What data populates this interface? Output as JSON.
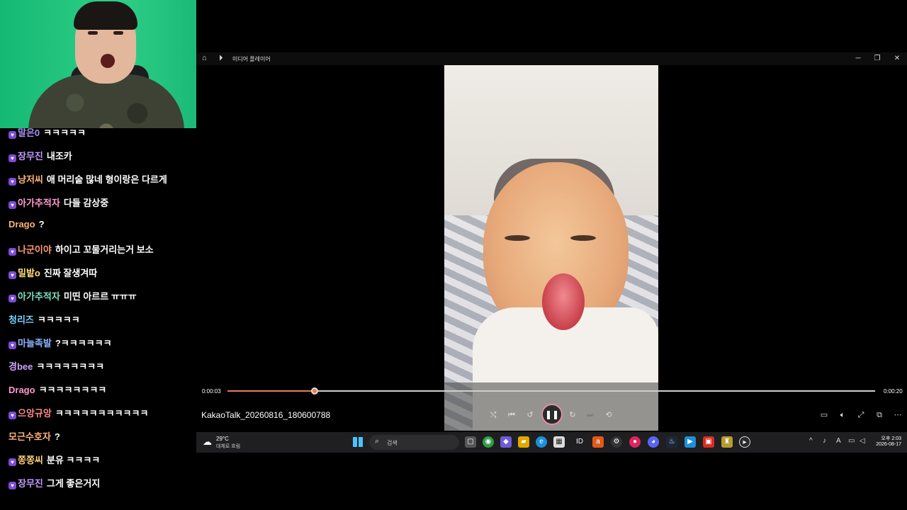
{
  "player": {
    "window_title": "미디어 플레이어",
    "file_name": "KakaoTalk_20260816_180600788",
    "time_elapsed": "0:00:03",
    "time_total": "0:00:20",
    "progress_fraction": 0.135,
    "accent_color": "#f07a4f"
  },
  "chat": {
    "messages": [
      {
        "nick": "말은0",
        "text": "ㅋㅋㅋㅋㅋ",
        "nick_color": "#a98df5",
        "badge": true
      },
      {
        "nick": "장무진",
        "text": "내조카",
        "nick_color": "#c49aff",
        "badge": true
      },
      {
        "nick": "냥저씨",
        "text": "애 머리숱 많네 형이랑은 다르게",
        "nick_color": "#ffb27a",
        "badge": true
      },
      {
        "nick": "아가추적자",
        "text": "다들 감상중",
        "nick_color": "#ff9ad0",
        "badge": true
      },
      {
        "nick": "Drago",
        "text": "?",
        "nick_color": "#ffb27a",
        "badge": false
      },
      {
        "nick": "나군이야",
        "text": "하이고 꼬물거리는거 보소",
        "nick_color": "#ff9a7a",
        "badge": true
      },
      {
        "nick": "밀밭o",
        "text": "진짜 잘생겨따",
        "nick_color": "#ffe17a",
        "badge": true
      },
      {
        "nick": "아가추적자",
        "text": "미띤 아르르 ㅠㅠㅠ",
        "nick_color": "#7ae0c0",
        "badge": true
      },
      {
        "nick": "청리즈",
        "text": "ㅋㅋㅋㅋㅋ",
        "nick_color": "#7ad0ff",
        "badge": false
      },
      {
        "nick": "마늘족발",
        "text": "?ㅋㅋㅋㅋㅋㅋ",
        "nick_color": "#8fb4ff",
        "badge": true
      },
      {
        "nick": "경bee",
        "text": "ㅋㅋㅋㅋㅋㅋㅋㅋ",
        "nick_color": "#cfa0ff",
        "badge": false
      },
      {
        "nick": "Drago",
        "text": "ㅋㅋㅋㅋㅋㅋㅋㅋ",
        "nick_color": "#ff9ad0",
        "badge": false
      },
      {
        "nick": "으앙규앙",
        "text": "ㅋㅋㅋㅋㅋㅋㅋㅋㅋㅋㅋ",
        "nick_color": "#ff8a8a",
        "badge": true
      },
      {
        "nick": "모근수호자",
        "text": "?",
        "nick_color": "#ffb27a",
        "badge": false
      },
      {
        "nick": "쫑쫑씨",
        "text": "분유 ㅋㅋㅋㅋ",
        "nick_color": "#ffd27a",
        "badge": true
      },
      {
        "nick": "장무진",
        "text": "그게 좋은거지",
        "nick_color": "#c49aff",
        "badge": true
      }
    ]
  },
  "taskbar": {
    "temperature": "29°C",
    "weather": "대체로 흐림",
    "search_placeholder": "검색",
    "clock_period": "오후 2:03",
    "date": "2026-08-17"
  },
  "icons": {
    "home": "home-icon",
    "media": "play-circle-icon",
    "shuffle": "shuffle-icon",
    "previous": "previous-icon",
    "rewind": "rewind-10-icon",
    "pause": "pause-icon",
    "forward": "forward-30-icon",
    "next": "next-icon",
    "repeat": "repeat-off-icon",
    "subtitles": "subtitles-icon",
    "volume": "volume-icon",
    "fullscreen": "fullscreen-icon",
    "miniplayer": "miniplayer-icon",
    "more": "more-icon"
  }
}
